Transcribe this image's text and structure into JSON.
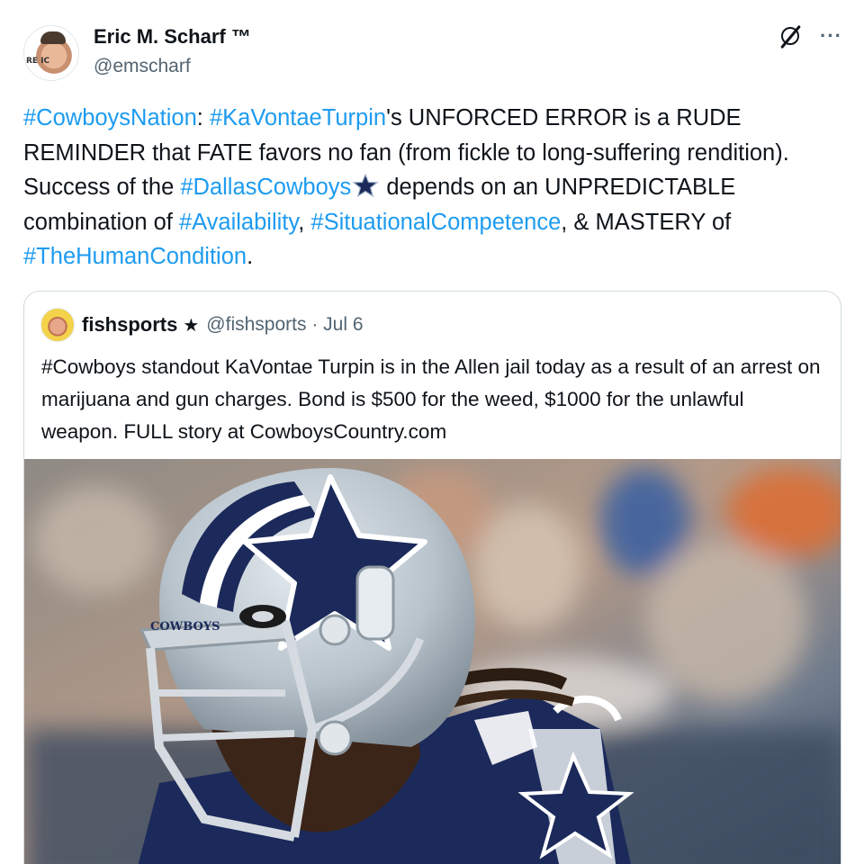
{
  "author": {
    "display_name": "Eric M. Scharf ™",
    "handle": "@emscharf",
    "avatar_text": "RE   IC"
  },
  "header_icons": {
    "grok": "grok-slash-circle-icon",
    "more": "···"
  },
  "tweet": {
    "segments": [
      {
        "t": "#CowboysNation",
        "tag": true
      },
      {
        "t": ": ",
        "tag": false
      },
      {
        "t": "#KaVontaeTurpin",
        "tag": true
      },
      {
        "t": "'s UNFORCED ERROR is a RUDE REMINDER that FATE favors no fan (from fickle to long-suffering rendition). Success of the ",
        "tag": false
      },
      {
        "t": "#DallasCowboys",
        "tag": true
      },
      {
        "t": "__STAR__",
        "tag": false
      },
      {
        "t": " depends on an UNPREDICTABLE combination of ",
        "tag": false
      },
      {
        "t": "#Availability",
        "tag": true
      },
      {
        "t": ", ",
        "tag": false
      },
      {
        "t": "#SituationalCompetence",
        "tag": true
      },
      {
        "t": ", & MASTERY of ",
        "tag": false
      },
      {
        "t": "#TheHumanCondition",
        "tag": true
      },
      {
        "t": ".",
        "tag": false
      }
    ]
  },
  "quote": {
    "display_name": "fishsports",
    "name_badge": "★",
    "meta": "@fishsports · Jul 6",
    "text": "#Cowboys standout KaVontae Turpin is in the Allen jail  today as a result of an arrest on marijuana and gun charges.  Bond is $500 for the weed, $1000 for the unlawful weapon. FULL story at CowboysCountry.com",
    "image_helmet_text": "COWBOYS"
  },
  "colors": {
    "link": "#1d9bf0",
    "text": "#0f1419",
    "secondary": "#536471",
    "border": "#cfd9de",
    "navy": "#1b2a5a",
    "helmet_silver": "#b8c3cc"
  }
}
